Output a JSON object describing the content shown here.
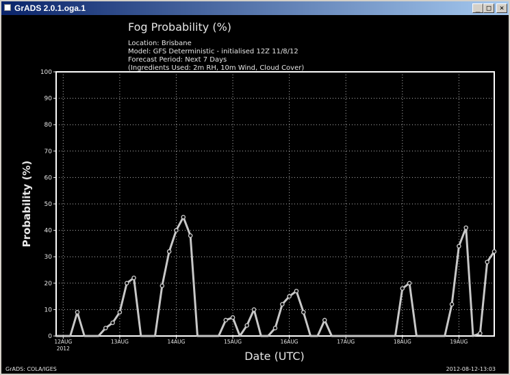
{
  "window": {
    "title": "GrADS 2.0.1.oga.1",
    "minimize_glyph": "_",
    "maximize_glyph": "□",
    "close_glyph": "×"
  },
  "plot": {
    "title": "Fog Probability (%)",
    "info_lines": [
      "Location:  Brisbane",
      "Model:  GFS Deterministic - initialised 12Z 11/8/12",
      "Forecast Period:  Next 7 Days",
      "(Ingredients Used: 2m RH, 10m Wind, Cloud Cover)"
    ],
    "footer_left": "GrADS: COLA/IGES",
    "footer_right": "2012-08-12-13:03"
  },
  "chart_data": {
    "type": "line",
    "title": "Fog Probability (%)",
    "xlabel": "Date (UTC)",
    "ylabel": "Probability (%)",
    "ylim": [
      0,
      100
    ],
    "yticks": [
      0,
      10,
      20,
      30,
      40,
      50,
      60,
      70,
      80,
      90,
      100
    ],
    "xlim": [
      "2012-08-11T21:00Z",
      "2012-08-19T15:00Z"
    ],
    "xticks": [
      {
        "t": "2012-08-12T00:00Z",
        "label": "12AUG",
        "sublabel": "2012"
      },
      {
        "t": "2012-08-13T00:00Z",
        "label": "13AUG"
      },
      {
        "t": "2012-08-14T00:00Z",
        "label": "14AUG"
      },
      {
        "t": "2012-08-15T00:00Z",
        "label": "15AUG"
      },
      {
        "t": "2012-08-16T00:00Z",
        "label": "16AUG"
      },
      {
        "t": "2012-08-17T00:00Z",
        "label": "17AUG"
      },
      {
        "t": "2012-08-18T00:00Z",
        "label": "18AUG"
      },
      {
        "t": "2012-08-19T00:00Z",
        "label": "19AUG"
      }
    ],
    "grid": true,
    "series": [
      {
        "color": "#c8c8c8",
        "points": [
          {
            "t": "2012-08-11T21:00Z",
            "y": 0
          },
          {
            "t": "2012-08-12T00:00Z",
            "y": 0
          },
          {
            "t": "2012-08-12T03:00Z",
            "y": 0
          },
          {
            "t": "2012-08-12T06:00Z",
            "y": 9
          },
          {
            "t": "2012-08-12T09:00Z",
            "y": 0
          },
          {
            "t": "2012-08-12T12:00Z",
            "y": 0
          },
          {
            "t": "2012-08-12T15:00Z",
            "y": 0
          },
          {
            "t": "2012-08-12T18:00Z",
            "y": 3
          },
          {
            "t": "2012-08-12T21:00Z",
            "y": 5
          },
          {
            "t": "2012-08-13T00:00Z",
            "y": 9
          },
          {
            "t": "2012-08-13T03:00Z",
            "y": 20
          },
          {
            "t": "2012-08-13T06:00Z",
            "y": 22
          },
          {
            "t": "2012-08-13T09:00Z",
            "y": 0
          },
          {
            "t": "2012-08-13T12:00Z",
            "y": 0
          },
          {
            "t": "2012-08-13T15:00Z",
            "y": 0
          },
          {
            "t": "2012-08-13T18:00Z",
            "y": 19
          },
          {
            "t": "2012-08-13T21:00Z",
            "y": 32
          },
          {
            "t": "2012-08-14T00:00Z",
            "y": 40
          },
          {
            "t": "2012-08-14T03:00Z",
            "y": 45
          },
          {
            "t": "2012-08-14T06:00Z",
            "y": 38
          },
          {
            "t": "2012-08-14T09:00Z",
            "y": 0
          },
          {
            "t": "2012-08-14T12:00Z",
            "y": 0
          },
          {
            "t": "2012-08-14T15:00Z",
            "y": 0
          },
          {
            "t": "2012-08-14T18:00Z",
            "y": 0
          },
          {
            "t": "2012-08-14T21:00Z",
            "y": 6
          },
          {
            "t": "2012-08-15T00:00Z",
            "y": 7
          },
          {
            "t": "2012-08-15T03:00Z",
            "y": 0
          },
          {
            "t": "2012-08-15T06:00Z",
            "y": 4
          },
          {
            "t": "2012-08-15T09:00Z",
            "y": 10
          },
          {
            "t": "2012-08-15T12:00Z",
            "y": 0
          },
          {
            "t": "2012-08-15T15:00Z",
            "y": 0
          },
          {
            "t": "2012-08-15T18:00Z",
            "y": 3
          },
          {
            "t": "2012-08-15T21:00Z",
            "y": 12
          },
          {
            "t": "2012-08-16T00:00Z",
            "y": 15
          },
          {
            "t": "2012-08-16T03:00Z",
            "y": 17
          },
          {
            "t": "2012-08-16T06:00Z",
            "y": 9
          },
          {
            "t": "2012-08-16T09:00Z",
            "y": 0
          },
          {
            "t": "2012-08-16T12:00Z",
            "y": 0
          },
          {
            "t": "2012-08-16T15:00Z",
            "y": 6
          },
          {
            "t": "2012-08-16T18:00Z",
            "y": 0
          },
          {
            "t": "2012-08-16T21:00Z",
            "y": 0
          },
          {
            "t": "2012-08-17T00:00Z",
            "y": 0
          },
          {
            "t": "2012-08-17T03:00Z",
            "y": 0
          },
          {
            "t": "2012-08-17T06:00Z",
            "y": 0
          },
          {
            "t": "2012-08-17T09:00Z",
            "y": 0
          },
          {
            "t": "2012-08-17T12:00Z",
            "y": 0
          },
          {
            "t": "2012-08-17T15:00Z",
            "y": 0
          },
          {
            "t": "2012-08-17T18:00Z",
            "y": 0
          },
          {
            "t": "2012-08-17T21:00Z",
            "y": 0
          },
          {
            "t": "2012-08-18T00:00Z",
            "y": 18
          },
          {
            "t": "2012-08-18T03:00Z",
            "y": 20
          },
          {
            "t": "2012-08-18T06:00Z",
            "y": 0
          },
          {
            "t": "2012-08-18T09:00Z",
            "y": 0
          },
          {
            "t": "2012-08-18T12:00Z",
            "y": 0
          },
          {
            "t": "2012-08-18T15:00Z",
            "y": 0
          },
          {
            "t": "2012-08-18T18:00Z",
            "y": 0
          },
          {
            "t": "2012-08-18T21:00Z",
            "y": 12
          },
          {
            "t": "2012-08-19T00:00Z",
            "y": 34
          },
          {
            "t": "2012-08-19T03:00Z",
            "y": 41
          },
          {
            "t": "2012-08-19T06:00Z",
            "y": 0
          },
          {
            "t": "2012-08-19T09:00Z",
            "y": 1
          },
          {
            "t": "2012-08-19T12:00Z",
            "y": 28
          },
          {
            "t": "2012-08-19T15:00Z",
            "y": 32
          }
        ]
      }
    ]
  }
}
